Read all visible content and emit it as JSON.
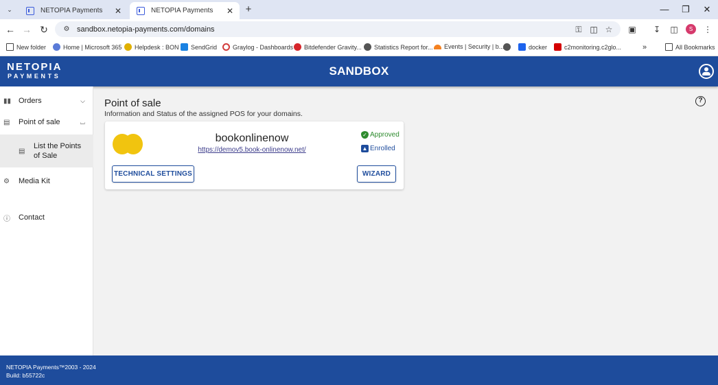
{
  "browser": {
    "tabs": [
      {
        "title": "NETOPIA Payments",
        "active": false
      },
      {
        "title": "NETOPIA Payments",
        "active": true
      }
    ],
    "url": "sandbox.netopia-payments.com/domains",
    "profile_initial": "S",
    "bookmarks": [
      {
        "label": "New folder",
        "icon": "folder-icon"
      },
      {
        "label": "Home | Microsoft 365",
        "icon": "m365-icon"
      },
      {
        "label": "Helpdesk : BON",
        "icon": "helpdesk-icon"
      },
      {
        "label": "SendGrid",
        "icon": "sendgrid-icon"
      },
      {
        "label": "Graylog - Dashboards",
        "icon": "graylog-icon"
      },
      {
        "label": "Bitdefender Gravity...",
        "icon": "bitdefender-icon"
      },
      {
        "label": "Statistics Report for...",
        "icon": "globe-icon"
      },
      {
        "label": "Events | Security | b...",
        "icon": "cloudflare-icon"
      },
      {
        "label": "",
        "icon": "globe-icon"
      },
      {
        "label": "docker",
        "icon": "docker-icon"
      },
      {
        "label": "c2monitoring.c2glo...",
        "icon": "zabbix-icon"
      }
    ],
    "all_bookmarks_label": "All Bookmarks"
  },
  "header": {
    "logo_line1": "NETOPIA",
    "logo_line2": "PAYMENTS",
    "environment": "SANDBOX"
  },
  "sidebar": {
    "items": [
      {
        "label": "Orders",
        "icon": "bar-chart-icon",
        "expanded": false
      },
      {
        "label": "Point of sale",
        "icon": "storage-icon",
        "expanded": true
      },
      {
        "label": "Media Kit",
        "icon": "gear-icon"
      },
      {
        "label": "Contact",
        "icon": "help-circle-icon"
      }
    ],
    "sub_item": {
      "label": "List the Points of Sale",
      "icon": "list-icon"
    }
  },
  "main": {
    "title": "Point of sale",
    "subtitle": "Information and Status of the assigned POS for your domains.",
    "pos": {
      "name": "bookonlinenow",
      "url": "https://demov5.book-onlinenow.net/",
      "status_approved": "Approved",
      "status_enrolled": "Enrolled",
      "technical_settings_label": "TECHNICAL SETTINGS",
      "wizard_label": "WIZARD",
      "logo_color": "#f1c40f"
    }
  },
  "footer": {
    "copyright": "NETOPIA Payments™2003 - 2024",
    "build": "Build: b55722c"
  },
  "colors": {
    "brand": "#1e4c9c",
    "approved": "#2e8b2e"
  }
}
